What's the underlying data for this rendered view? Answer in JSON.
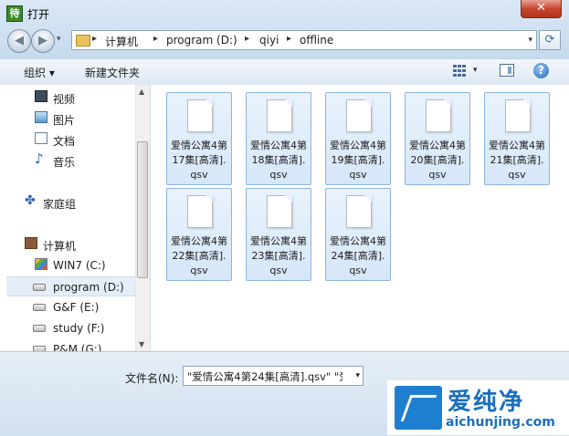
{
  "window": {
    "title": "打开",
    "app_icon_text": "待",
    "close_glyph": "✕"
  },
  "nav": {
    "back_glyph": "◀",
    "forward_glyph": "▶",
    "history_glyph": "▾",
    "breadcrumb": [
      {
        "label": "计算机"
      },
      {
        "label": "program (D:)"
      },
      {
        "label": "qiyi"
      },
      {
        "label": "offline"
      }
    ],
    "separator_glyph": "▸",
    "address_dropdown_glyph": "▾",
    "refresh_glyph": "⟳"
  },
  "toolbar": {
    "organize_label": "组织 ▾",
    "new_folder_label": "新建文件夹",
    "views_arrow": "▾",
    "help_label": "?"
  },
  "sidebar": {
    "items": [
      {
        "label": "视频",
        "icon": "video-icon"
      },
      {
        "label": "图片",
        "icon": "pictures-icon"
      },
      {
        "label": "文档",
        "icon": "documents-icon"
      },
      {
        "label": "音乐",
        "icon": "music-icon",
        "glyph": "♪"
      },
      {
        "label": "家庭组",
        "icon": "homegroup-icon",
        "glyph": "✤"
      },
      {
        "label": "计算机",
        "icon": "computer-icon"
      },
      {
        "label": "WIN7 (C:)",
        "icon": "windows-drive-icon"
      },
      {
        "label": "program (D:)",
        "icon": "drive-icon",
        "selected": true
      },
      {
        "label": "G&F (E:)",
        "icon": "drive-icon"
      },
      {
        "label": "study (F:)",
        "icon": "drive-icon"
      },
      {
        "label": "P&M (G:)",
        "icon": "drive-icon"
      }
    ],
    "scroll_up": "▲",
    "scroll_down": "▼"
  },
  "files": [
    {
      "name": "爱情公寓4第17集[高清].qsv"
    },
    {
      "name": "爱情公寓4第18集[高清].qsv"
    },
    {
      "name": "爱情公寓4第19集[高清].qsv"
    },
    {
      "name": "爱情公寓4第20集[高清].qsv"
    },
    {
      "name": "爱情公寓4第21集[高清].qsv"
    },
    {
      "name": "爱情公寓4第22集[高清].qsv"
    },
    {
      "name": "爱情公寓4第23集[高清].qsv"
    },
    {
      "name": "爱情公寓4第24集[高清].qsv"
    }
  ],
  "bottom": {
    "filename_label": "文件名(N):",
    "filename_value": "\"爱情公寓4第24集[高清].qsv\" \"爱",
    "filename_dropdown": "▾"
  },
  "watermark": {
    "title": "爱纯净",
    "url": "aichunjing.com"
  },
  "colors": {
    "selection_fill": "#d6e7f8",
    "selection_border": "#8db5e2",
    "watermark_blue": "#1a6fbd"
  }
}
